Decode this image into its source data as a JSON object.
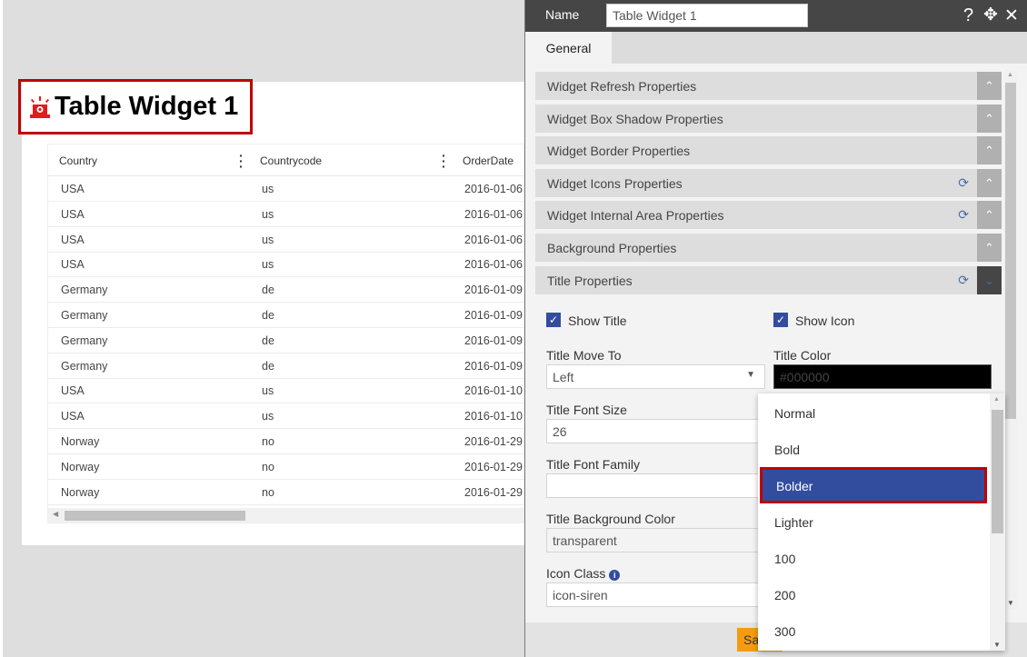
{
  "widget": {
    "title": "Table Widget 1",
    "icon": "siren-icon",
    "columns": [
      "Country",
      "Countrycode",
      "OrderDate"
    ],
    "rows": [
      [
        "USA",
        "us",
        "2016-01-06"
      ],
      [
        "USA",
        "us",
        "2016-01-06"
      ],
      [
        "USA",
        "us",
        "2016-01-06"
      ],
      [
        "USA",
        "us",
        "2016-01-06"
      ],
      [
        "Germany",
        "de",
        "2016-01-09"
      ],
      [
        "Germany",
        "de",
        "2016-01-09"
      ],
      [
        "Germany",
        "de",
        "2016-01-09"
      ],
      [
        "Germany",
        "de",
        "2016-01-09"
      ],
      [
        "USA",
        "us",
        "2016-01-10"
      ],
      [
        "USA",
        "us",
        "2016-01-10"
      ],
      [
        "Norway",
        "no",
        "2016-01-29"
      ],
      [
        "Norway",
        "no",
        "2016-01-29"
      ],
      [
        "Norway",
        "no",
        "2016-01-29"
      ]
    ]
  },
  "panel": {
    "name_label": "Name",
    "name_value": "Table Widget 1",
    "help": "?",
    "tab": "General",
    "sections": [
      "Widget Refresh Properties",
      "Widget Box Shadow Properties",
      "Widget Border Properties",
      "Widget Icons Properties",
      "Widget Internal Area Properties",
      "Background Properties",
      "Title Properties"
    ],
    "show_title": "Show Title",
    "show_icon": "Show Icon",
    "title_move_label": "Title Move To",
    "title_move_value": "Left",
    "title_color_label": "Title Color",
    "title_color_value": "#000000",
    "font_size_label": "Title Font Size",
    "font_size_value": "26",
    "font_family_label": "Title Font Family",
    "font_family_value": "",
    "bg_color_label": "Title Background Color",
    "bg_color_value": "transparent",
    "icon_class_label": "Icon Class",
    "icon_class_value": "icon-siren",
    "save": "Sa"
  },
  "dropdown": {
    "options": [
      "Normal",
      "Bold",
      "Bolder",
      "Lighter",
      "100",
      "200",
      "300"
    ],
    "selected": "Bolder"
  },
  "colors": {
    "accent": "#334d9e",
    "highlight_border": "#c00000",
    "save": "#f39c12"
  }
}
